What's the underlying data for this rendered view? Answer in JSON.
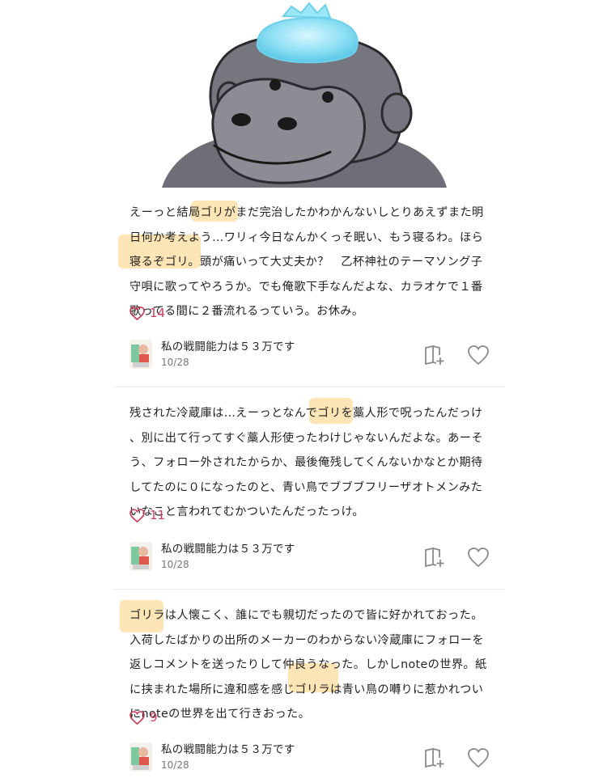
{
  "posts": [
    {
      "lines": [
        "えーっと結局ゴリがまだ完治したかわかんないしとりあえずまた明",
        "日何か考えよう…ワリィ今日なんかくっそ眠い、もう寝るわ。ほら",
        "寝るぞゴリ。頭が痛いって大丈夫か？　乙杯神社のテーマソング子",
        "守唄に歌ってやろうか。でも俺歌下手なんだよな、カラオケで１番",
        "歌ってる間に２番流れるっていう。お休み。"
      ],
      "likes": "14",
      "author": "私の戦闘能力は５３万です",
      "date": "10/28"
    },
    {
      "lines": [
        "残された冷蔵庫は…えーっとなんでゴリを藁人形で呪ったんだっけ",
        "、別に出て行ってすぐ藁人形使ったわけじゃないんだよな。あーそ",
        "う、フォロー外されたからか、最後俺残してくんないかなとか期待",
        "してたのに０になったのと、青い鳥でブブブフリーザオトメンみた",
        "いなこと言われてむかついたんだったっけ。"
      ],
      "likes": "11",
      "author": "私の戦闘能力は５３万です",
      "date": "10/28"
    },
    {
      "lines": [
        "ゴリラは人懐こく、誰にでも親切だったので皆に好かれておった。",
        "入荷したばかりの出所のメーカーのわからない冷蔵庫にフォローを",
        "返しコメントを送ったりして仲良うなった。しかしnoteの世界。紙",
        "に挟まれた場所に違和感を感じゴリラは青い鳥の囀りに惹かれつい",
        "にnoteの世界を出て行きおった。"
      ],
      "likes": "9",
      "author": "私の戦闘能力は５３万です",
      "date": "10/28"
    }
  ]
}
